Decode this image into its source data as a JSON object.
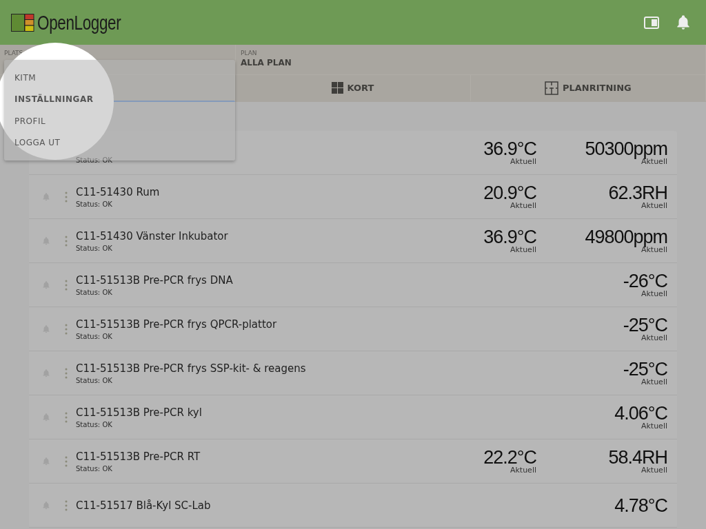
{
  "header": {
    "title": "OpenLogger"
  },
  "filters": [
    {
      "label": "PLATS"
    },
    {
      "label": "PLAN",
      "value": "ALLA PLAN"
    }
  ],
  "tabs": [
    {
      "selected": true
    },
    {
      "label": "KORT",
      "selected": false
    },
    {
      "label": "PLANRITNING",
      "selected": false
    }
  ],
  "menu": {
    "items": [
      {
        "label": "KITM",
        "selected": false
      },
      {
        "label": "INSTÄLLNINGAR",
        "selected": true
      },
      {
        "label": "PROFIL",
        "selected": false
      },
      {
        "label": "LOGGA UT",
        "selected": false
      }
    ]
  },
  "sensors": [
    {
      "status": "Status: OK",
      "readings": [
        {
          "value": "36.9",
          "unit": "°C",
          "caption": "Aktuell"
        },
        {
          "value": "50300",
          "unit": "ppm",
          "caption": "Aktuell"
        }
      ]
    },
    {
      "name": "C11-51430 Rum",
      "status": "Status: OK",
      "readings": [
        {
          "value": "20.9",
          "unit": "°C",
          "caption": "Aktuell"
        },
        {
          "value": "62.3",
          "unit": "RH",
          "caption": "Aktuell"
        }
      ]
    },
    {
      "name": "C11-51430 Vänster Inkubator",
      "status": "Status: OK",
      "readings": [
        {
          "value": "36.9",
          "unit": "°C",
          "caption": "Aktuell"
        },
        {
          "value": "49800",
          "unit": "ppm",
          "caption": "Aktuell"
        }
      ]
    },
    {
      "name": "C11-51513B Pre-PCR frys DNA",
      "status": "Status: OK",
      "readings": [
        {
          "value": "-26",
          "unit": "°C",
          "caption": "Aktuell"
        }
      ]
    },
    {
      "name": "C11-51513B Pre-PCR frys QPCR-plattor",
      "status": "Status: OK",
      "readings": [
        {
          "value": "-25",
          "unit": "°C",
          "caption": "Aktuell"
        }
      ]
    },
    {
      "name": "C11-51513B Pre-PCR frys SSP-kit- & reagens",
      "status": "Status: OK",
      "readings": [
        {
          "value": "-25",
          "unit": "°C",
          "caption": "Aktuell"
        }
      ]
    },
    {
      "name": "C11-51513B Pre-PCR kyl",
      "status": "Status: OK",
      "readings": [
        {
          "value": "4.06",
          "unit": "°C",
          "caption": "Aktuell"
        }
      ]
    },
    {
      "name": "C11-51513B Pre-PCR RT",
      "status": "Status: OK",
      "readings": [
        {
          "value": "22.2",
          "unit": "°C",
          "caption": "Aktuell"
        },
        {
          "value": "58.4",
          "unit": "RH",
          "caption": "Aktuell"
        }
      ]
    },
    {
      "name": "C11-51517 Blå-Kyl SC-Lab",
      "readings": [
        {
          "value": "4.78",
          "unit": "°C"
        }
      ]
    }
  ]
}
